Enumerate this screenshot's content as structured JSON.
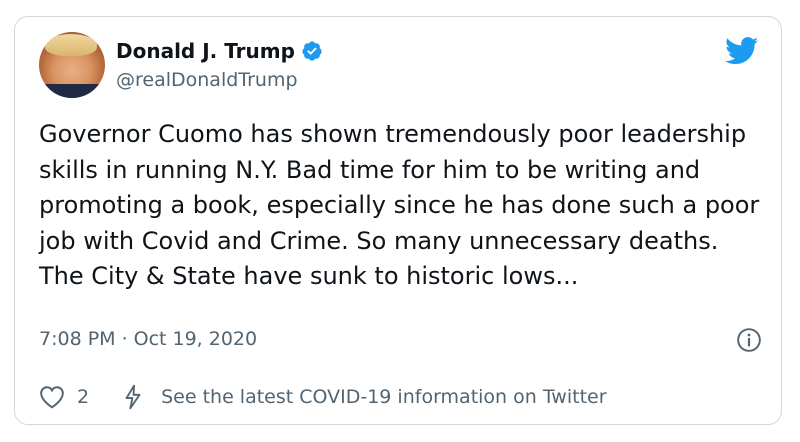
{
  "user": {
    "name": "Donald J. Trump",
    "handle": "@realDonaldTrump"
  },
  "tweet": {
    "text": "Governor Cuomo has shown tremendously poor leadership skills in running N.Y. Bad time for him to be writing and promoting a book, especially since he has done such a poor job with Covid and Crime. So many unnecessary deaths. The City & State have sunk to historic lows...",
    "time": "7:08 PM",
    "separator": "·",
    "date": "Oct 19, 2020"
  },
  "actions": {
    "like_count": "2",
    "covid_link": "See the latest COVID-19 information on Twitter"
  },
  "icons": {
    "verified": "verified-badge-icon",
    "twitter": "twitter-bird-icon",
    "info": "info-icon",
    "like": "heart-icon",
    "covid": "lightning-icon"
  },
  "colors": {
    "twitter_blue": "#1d9bf0",
    "text": "#0f1419",
    "secondary": "#536471",
    "border": "#cfd9de"
  }
}
